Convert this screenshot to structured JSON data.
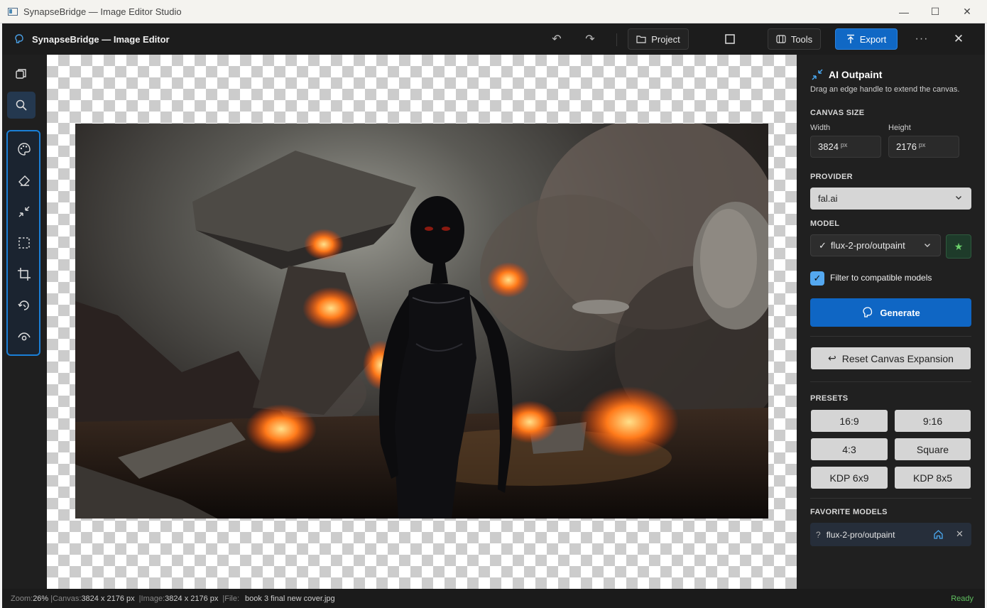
{
  "window": {
    "title": "SynapseBridge — Image Editor Studio"
  },
  "header": {
    "app_title": "SynapseBridge — Image Editor",
    "project_label": "Project",
    "tools_label": "Tools",
    "export_label": "Export"
  },
  "panel": {
    "title": "AI Outpaint",
    "hint": "Drag an edge handle to extend the canvas.",
    "canvas_size_label": "CANVAS SIZE",
    "width_label": "Width",
    "height_label": "Height",
    "width_value": "3824",
    "height_value": "2176",
    "unit": "px",
    "provider_label": "PROVIDER",
    "provider_value": "fal.ai",
    "model_label": "MODEL",
    "model_value": "flux-2-pro/outpaint",
    "model_check": "✓",
    "filter_label": "Filter to compatible models",
    "filter_checked": true,
    "generate_label": "Generate",
    "reset_label": "Reset Canvas Expansion",
    "presets_label": "PRESETS",
    "presets": [
      "16:9",
      "9:16",
      "4:3",
      "Square",
      "KDP 6x9",
      "KDP 8x5"
    ],
    "favorites_label": "FAVORITE MODELS",
    "favorite": {
      "prefix": "?",
      "name": "flux-2-pro/outpaint"
    }
  },
  "status": {
    "zoom_label": "Zoom:",
    "zoom_value": "26%",
    "canvas_label": "Canvas:",
    "canvas_value": "3824 x 2176 px",
    "image_label": "Image:",
    "image_value": "3824 x 2176 px",
    "file_label": "File:",
    "file_value": "book 3 final new cover.jpg",
    "state": "Ready"
  },
  "colors": {
    "accent": "#1068c5",
    "ready": "#5fbf5f",
    "panel_bg": "#202020"
  }
}
